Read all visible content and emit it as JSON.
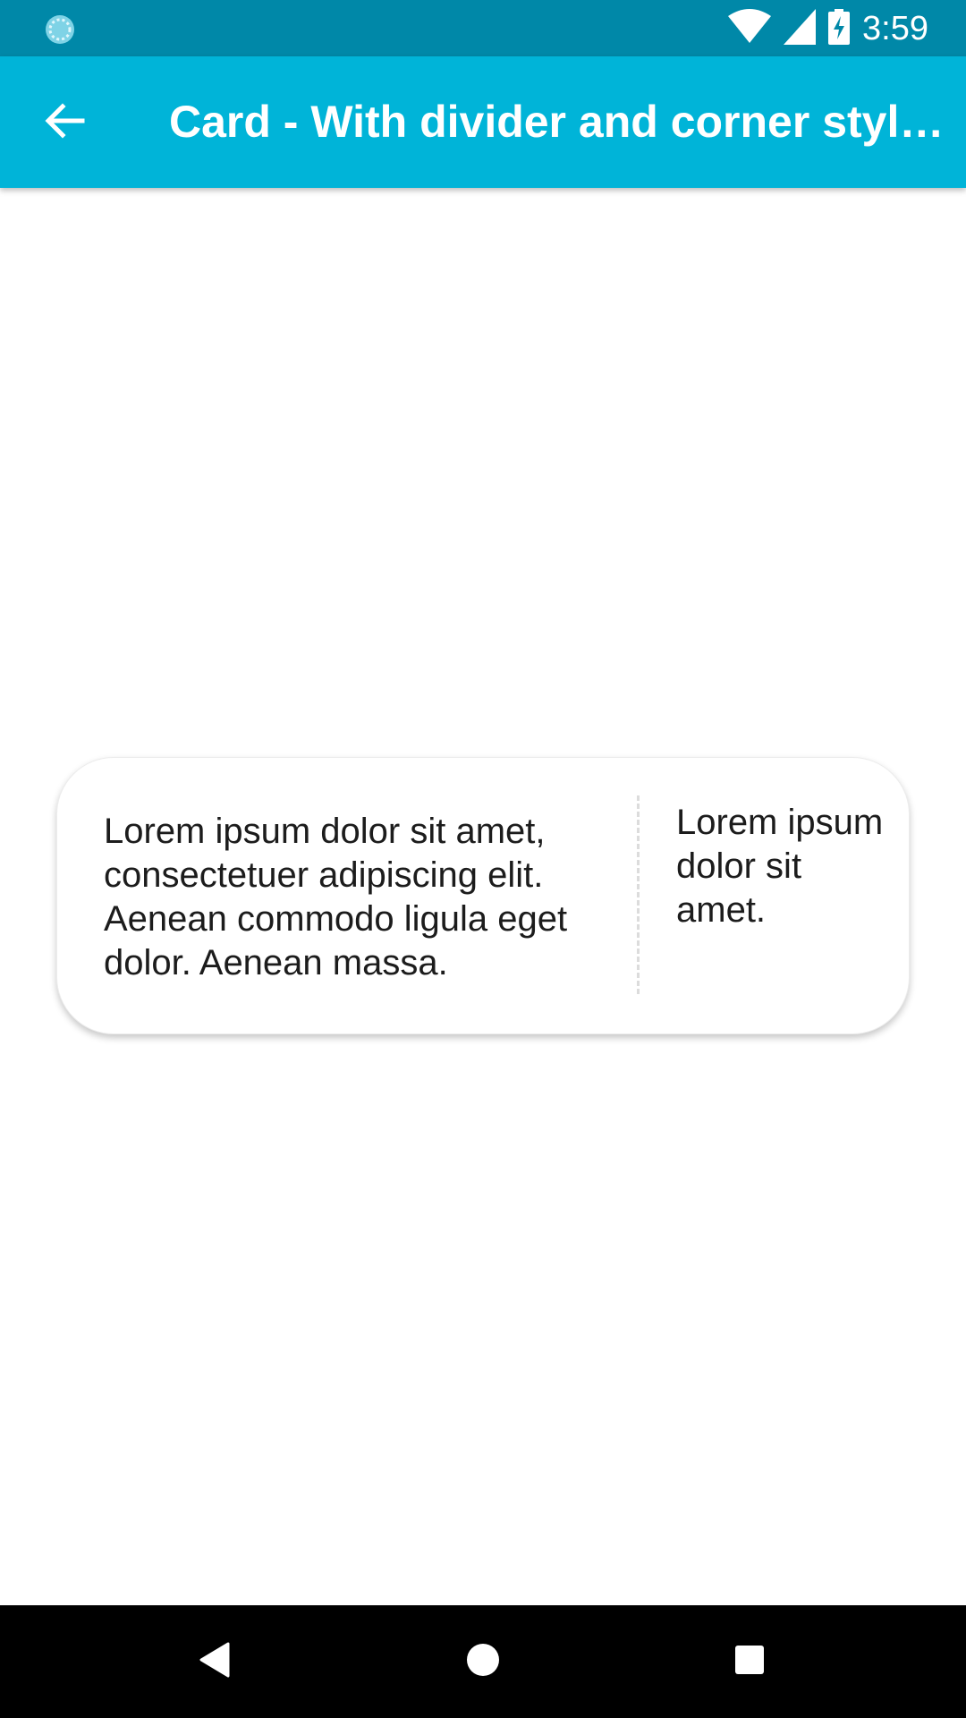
{
  "status_bar": {
    "time": "3:59",
    "icons": [
      "sync-icon",
      "wifi-icon",
      "cell-signal-icon",
      "battery-charging-icon"
    ]
  },
  "app_bar": {
    "title": "Card - With divider and corner style…",
    "back_icon": "arrow-back-icon"
  },
  "card": {
    "main_text": "Lorem ipsum dolor sit amet, consectetuer adipiscing elit. Aenean commodo ligula eget dolor. Aenean massa.",
    "side_text": "Lorem ipsum dolor sit amet."
  },
  "nav_bar": {
    "icons": [
      "back-triangle-icon",
      "home-circle-icon",
      "recents-square-icon"
    ]
  },
  "colors": {
    "status_bar": "#0088a8",
    "app_bar": "#00b4d8",
    "nav_bar": "#000000"
  }
}
